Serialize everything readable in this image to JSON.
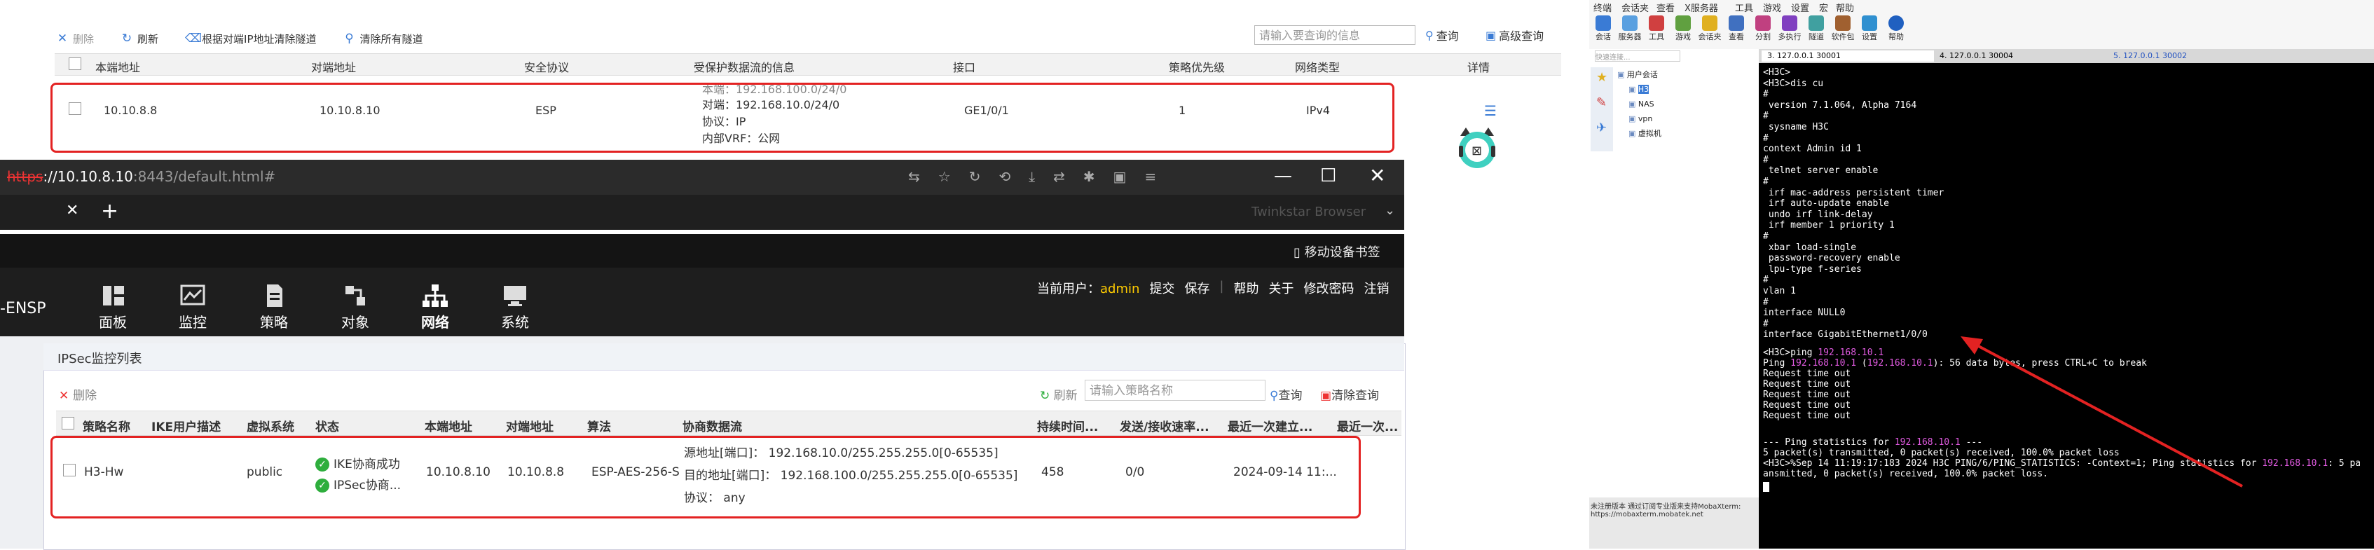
{
  "back_window": {
    "toolbar": {
      "delete": "删除",
      "refresh": "刷新",
      "clear_by_peer": "根据对端IP地址清除隧道",
      "clear_all": "清除所有隧道",
      "search_placeholder": "请输入要查询的信息",
      "query": "查询",
      "advanced": "高级查询"
    },
    "columns": [
      "本端地址",
      "对端地址",
      "安全协议",
      "受保护数据流的信息",
      "接口",
      "策略优先级",
      "网络类型",
      "详情"
    ],
    "row": {
      "local": "10.10.8.8",
      "peer": "10.10.8.10",
      "protocol": "ESP",
      "flow_local": "本端：192.168.100.0/24/0",
      "flow_peer": "对端：192.168.10.0/24/0",
      "flow_proto": "协议：IP",
      "flow_vrf": "内部VRF：公网",
      "iface": "GE1/0/1",
      "priority": "1",
      "net_type": "IPv4"
    }
  },
  "browser": {
    "url_scheme": "https",
    "url_host": "://10.10.8.10",
    "url_rest": ":8443/default.html#",
    "brand": "Twinkstar Browser",
    "bookmark": "移动设备书签",
    "app_title": "-ENSP",
    "user_label": "当前用户：",
    "user": "admin",
    "top_links": [
      "提交",
      "保存",
      "帮助",
      "关于",
      "修改密码",
      "注销"
    ],
    "nav": [
      "面板",
      "监控",
      "策略",
      "对象",
      "网络",
      "系统"
    ],
    "panel_title": "IPSec监控列表",
    "delete": "删除",
    "refresh": "刷新",
    "search_placeholder": "请输入策略名称",
    "query": "查询",
    "clear_query": "清除查询",
    "columns": [
      "策略名称",
      "IKE用户描述",
      "虚拟系统",
      "状态",
      "本端地址",
      "对端地址",
      "算法",
      "协商数据流",
      "持续时间...",
      "发送/接收速率...",
      "最近一次建立...",
      "最近一次..."
    ],
    "row": {
      "name": "H3-Hw",
      "vsys": "public",
      "status1": "IKE协商成功",
      "status2": "IPSec协商...",
      "local": "10.10.8.10",
      "peer": "10.10.8.8",
      "algo": "ESP-AES-256-S",
      "flow_src": "源地址[端口]：  192.168.10.0/255.255.255.0[0-65535]",
      "flow_dst": "目的地址[端口]：  192.168.100.0/255.255.255.0[0-65535]",
      "flow_proto": "协议：  any",
      "duration": "458",
      "rate": "0/0",
      "last": "2024-09-14 11:..."
    }
  },
  "right_pane": {
    "menu": [
      "终端",
      "会话夹",
      "查看",
      "X服务器",
      "工具",
      "游戏",
      "设置",
      "宏",
      "帮助"
    ],
    "tools": [
      "会话",
      "服务器",
      "工具",
      "游戏",
      "会话夹",
      "查看",
      "分割",
      "多执行",
      "隧道",
      "软件包",
      "设置",
      "帮助"
    ],
    "tabs": [
      "3. 127.0.0.1 30001",
      "4. 127.0.0.1 30004",
      "5. 127.0.0.1 30002"
    ],
    "tree": [
      "用户会话",
      "H3",
      "NAS",
      "vpn",
      "虚拟机"
    ],
    "search_placeholder": "快速连接...",
    "terminal_lines": [
      "<H3C>",
      "<H3C>dis cu",
      "#",
      " version 7.1.064, Alpha 7164",
      "#",
      " sysname H3C",
      "#",
      "context Admin id 1",
      "#",
      " telnet server enable",
      "#",
      " irf mac-address persistent timer",
      " irf auto-update enable",
      " undo irf link-delay",
      " irf member 1 priority 1",
      "#",
      " xbar load-single",
      " password-recovery enable",
      " lpu-type f-series",
      "#",
      "vlan 1",
      "#",
      "interface NULL0",
      "#",
      "interface GigabitEthernet1/0/0"
    ],
    "ping_cmd": "<H3C>ping ",
    "ping_ip": "192.168.10.1",
    "ping_line_a": "Ping ",
    "ping_line_b": " (",
    "ping_line_c": "): 56 data bytes, press CTRL+C to break",
    "timeouts": [
      "Request time out",
      "Request time out",
      "Request time out",
      "Request time out",
      "Request time out"
    ],
    "stats_a": "--- Ping statistics for ",
    "stats_b": " ---",
    "stats_line1": "5 packet(s) transmitted, 0 packet(s) received, 100.0% packet loss",
    "stats_line2": "<H3C>%Sep 14 11:19:17:183 2024 H3C PING/6/PING_STATISTICS: -Context=1; Ping statistics for ",
    "stats_line2_tail": ": 5 pa",
    "stats_line3": "ansmitted, 0 packet(s) received, 100.0% packet loss.",
    "status_bar": "未注册版本  通过订阅专业版来支持MobaXterm: https://mobaxterm.mobatek.net"
  }
}
